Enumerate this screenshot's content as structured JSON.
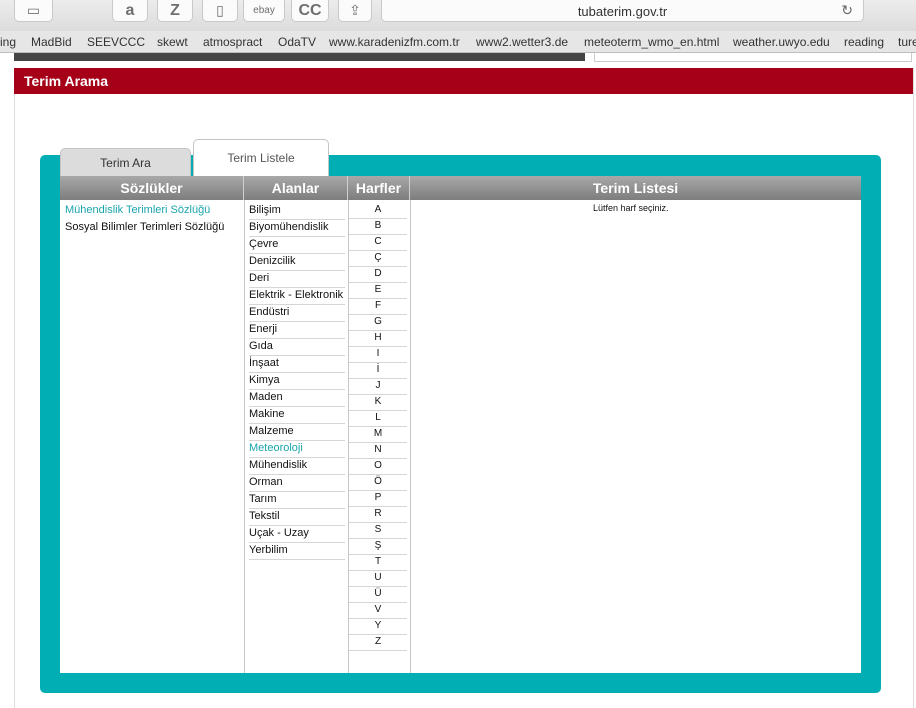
{
  "browser": {
    "url": "tubaterim.gov.tr",
    "toolbar_buttons": [
      {
        "name": "sidebar-icon",
        "label": ""
      },
      {
        "name": "amazon-icon",
        "label": "a"
      },
      {
        "name": "z-icon",
        "label": "Z"
      },
      {
        "name": "bookmark-icon",
        "label": ""
      },
      {
        "name": "ebay-icon",
        "label": "ebay"
      },
      {
        "name": "cc-icon",
        "label": "CC"
      },
      {
        "name": "share-icon",
        "label": ""
      }
    ],
    "bookmarks": [
      "ing",
      "MadBid",
      "SEEVCCC",
      "skewt",
      "atmospract",
      "OdaTV",
      "www.karadenizfm.com.tr",
      "www2.wetter3.de",
      "meteoterm_wmo_en.html",
      "weather.uwyo.edu",
      "reading",
      "ture"
    ]
  },
  "page": {
    "header_title": "Terim Arama",
    "tabs": [
      "Terim Ara",
      "Terim Listele"
    ],
    "active_tab": "Terim Listele",
    "columns": {
      "dictionaries": "Sözlükler",
      "areas": "Alanlar",
      "letters": "Harfler",
      "term_list": "Terim Listesi"
    },
    "dictionaries": [
      "Mühendislik Terimleri Sözlüğü",
      "Sosyal Bilimler Terimleri Sözlüğü"
    ],
    "active_dictionary": "Mühendislik Terimleri Sözlüğü",
    "areas": [
      "Bilişim",
      "Biyomühendislik",
      "Çevre",
      "Denizcilik",
      "Deri",
      "Elektrik - Elektronik",
      "Endüstri",
      "Enerji",
      "Gıda",
      "İnşaat",
      "Kimya",
      "Maden",
      "Makine",
      "Malzeme",
      "Meteoroloji",
      "Mühendislik",
      "Orman",
      "Tarım",
      "Tekstil",
      "Uçak - Uzay",
      "Yerbilim"
    ],
    "active_area": "Meteoroloji",
    "letters": [
      "A",
      "B",
      "C",
      "Ç",
      "D",
      "E",
      "F",
      "G",
      "H",
      "I",
      "İ",
      "J",
      "K",
      "L",
      "M",
      "N",
      "O",
      "Ö",
      "P",
      "R",
      "S",
      "Ş",
      "T",
      "U",
      "Ü",
      "V",
      "Y",
      "Z"
    ],
    "term_list_message": "Lütfen harf seçiniz."
  },
  "colors": {
    "header": "#a50018",
    "panel": "#00aeb4",
    "active_link": "#1aa4ad"
  }
}
